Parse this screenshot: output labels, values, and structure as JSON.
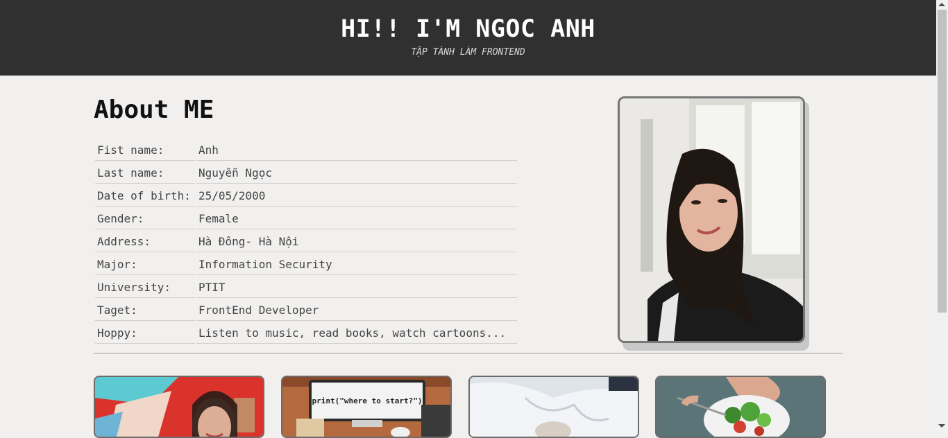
{
  "header": {
    "title": "HI!! I'M NGOC ANH",
    "subtitle": "TẬP TÀNH LÀM FRONTEND"
  },
  "about": {
    "title": "About ME",
    "rows": [
      {
        "label": "Fist name:",
        "value": "Anh"
      },
      {
        "label": "Last name:",
        "value": "Nguyễn Ngọc"
      },
      {
        "label": "Date of birth:",
        "value": "25/05/2000"
      },
      {
        "label": "Gender:",
        "value": "Female"
      },
      {
        "label": "Address:",
        "value": "Hà Đông- Hà Nội"
      },
      {
        "label": "Major:",
        "value": "Information Security"
      },
      {
        "label": "University:",
        "value": "PTIT"
      },
      {
        "label": "Taget:",
        "value": "FrontEnd Developer"
      },
      {
        "label": "Hoppy:",
        "value": "Listen to music, read books, watch cartoons..."
      }
    ]
  },
  "gallery": {
    "thumb2_caption": "print(\"where to start?\")"
  },
  "colors": {
    "header_bg": "#303030",
    "page_bg": "#f1f0ef",
    "frame_border": "#757575"
  }
}
